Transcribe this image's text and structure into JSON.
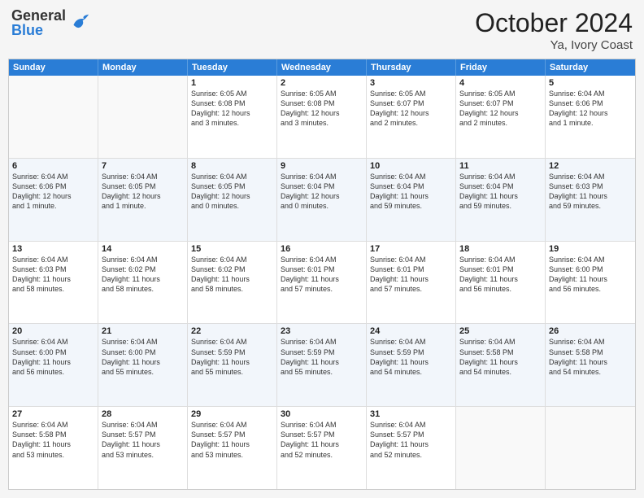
{
  "logo": {
    "general": "General",
    "blue": "Blue"
  },
  "title": "October 2024",
  "subtitle": "Ya, Ivory Coast",
  "header": {
    "days": [
      "Sunday",
      "Monday",
      "Tuesday",
      "Wednesday",
      "Thursday",
      "Friday",
      "Saturday"
    ]
  },
  "rows": [
    {
      "cells": [
        {
          "day": "",
          "lines": []
        },
        {
          "day": "",
          "lines": []
        },
        {
          "day": "1",
          "lines": [
            "Sunrise: 6:05 AM",
            "Sunset: 6:08 PM",
            "Daylight: 12 hours",
            "and 3 minutes."
          ]
        },
        {
          "day": "2",
          "lines": [
            "Sunrise: 6:05 AM",
            "Sunset: 6:08 PM",
            "Daylight: 12 hours",
            "and 3 minutes."
          ]
        },
        {
          "day": "3",
          "lines": [
            "Sunrise: 6:05 AM",
            "Sunset: 6:07 PM",
            "Daylight: 12 hours",
            "and 2 minutes."
          ]
        },
        {
          "day": "4",
          "lines": [
            "Sunrise: 6:05 AM",
            "Sunset: 6:07 PM",
            "Daylight: 12 hours",
            "and 2 minutes."
          ]
        },
        {
          "day": "5",
          "lines": [
            "Sunrise: 6:04 AM",
            "Sunset: 6:06 PM",
            "Daylight: 12 hours",
            "and 1 minute."
          ]
        }
      ]
    },
    {
      "cells": [
        {
          "day": "6",
          "lines": [
            "Sunrise: 6:04 AM",
            "Sunset: 6:06 PM",
            "Daylight: 12 hours",
            "and 1 minute."
          ]
        },
        {
          "day": "7",
          "lines": [
            "Sunrise: 6:04 AM",
            "Sunset: 6:05 PM",
            "Daylight: 12 hours",
            "and 1 minute."
          ]
        },
        {
          "day": "8",
          "lines": [
            "Sunrise: 6:04 AM",
            "Sunset: 6:05 PM",
            "Daylight: 12 hours",
            "and 0 minutes."
          ]
        },
        {
          "day": "9",
          "lines": [
            "Sunrise: 6:04 AM",
            "Sunset: 6:04 PM",
            "Daylight: 12 hours",
            "and 0 minutes."
          ]
        },
        {
          "day": "10",
          "lines": [
            "Sunrise: 6:04 AM",
            "Sunset: 6:04 PM",
            "Daylight: 11 hours",
            "and 59 minutes."
          ]
        },
        {
          "day": "11",
          "lines": [
            "Sunrise: 6:04 AM",
            "Sunset: 6:04 PM",
            "Daylight: 11 hours",
            "and 59 minutes."
          ]
        },
        {
          "day": "12",
          "lines": [
            "Sunrise: 6:04 AM",
            "Sunset: 6:03 PM",
            "Daylight: 11 hours",
            "and 59 minutes."
          ]
        }
      ]
    },
    {
      "cells": [
        {
          "day": "13",
          "lines": [
            "Sunrise: 6:04 AM",
            "Sunset: 6:03 PM",
            "Daylight: 11 hours",
            "and 58 minutes."
          ]
        },
        {
          "day": "14",
          "lines": [
            "Sunrise: 6:04 AM",
            "Sunset: 6:02 PM",
            "Daylight: 11 hours",
            "and 58 minutes."
          ]
        },
        {
          "day": "15",
          "lines": [
            "Sunrise: 6:04 AM",
            "Sunset: 6:02 PM",
            "Daylight: 11 hours",
            "and 58 minutes."
          ]
        },
        {
          "day": "16",
          "lines": [
            "Sunrise: 6:04 AM",
            "Sunset: 6:01 PM",
            "Daylight: 11 hours",
            "and 57 minutes."
          ]
        },
        {
          "day": "17",
          "lines": [
            "Sunrise: 6:04 AM",
            "Sunset: 6:01 PM",
            "Daylight: 11 hours",
            "and 57 minutes."
          ]
        },
        {
          "day": "18",
          "lines": [
            "Sunrise: 6:04 AM",
            "Sunset: 6:01 PM",
            "Daylight: 11 hours",
            "and 56 minutes."
          ]
        },
        {
          "day": "19",
          "lines": [
            "Sunrise: 6:04 AM",
            "Sunset: 6:00 PM",
            "Daylight: 11 hours",
            "and 56 minutes."
          ]
        }
      ]
    },
    {
      "cells": [
        {
          "day": "20",
          "lines": [
            "Sunrise: 6:04 AM",
            "Sunset: 6:00 PM",
            "Daylight: 11 hours",
            "and 56 minutes."
          ]
        },
        {
          "day": "21",
          "lines": [
            "Sunrise: 6:04 AM",
            "Sunset: 6:00 PM",
            "Daylight: 11 hours",
            "and 55 minutes."
          ]
        },
        {
          "day": "22",
          "lines": [
            "Sunrise: 6:04 AM",
            "Sunset: 5:59 PM",
            "Daylight: 11 hours",
            "and 55 minutes."
          ]
        },
        {
          "day": "23",
          "lines": [
            "Sunrise: 6:04 AM",
            "Sunset: 5:59 PM",
            "Daylight: 11 hours",
            "and 55 minutes."
          ]
        },
        {
          "day": "24",
          "lines": [
            "Sunrise: 6:04 AM",
            "Sunset: 5:59 PM",
            "Daylight: 11 hours",
            "and 54 minutes."
          ]
        },
        {
          "day": "25",
          "lines": [
            "Sunrise: 6:04 AM",
            "Sunset: 5:58 PM",
            "Daylight: 11 hours",
            "and 54 minutes."
          ]
        },
        {
          "day": "26",
          "lines": [
            "Sunrise: 6:04 AM",
            "Sunset: 5:58 PM",
            "Daylight: 11 hours",
            "and 54 minutes."
          ]
        }
      ]
    },
    {
      "cells": [
        {
          "day": "27",
          "lines": [
            "Sunrise: 6:04 AM",
            "Sunset: 5:58 PM",
            "Daylight: 11 hours",
            "and 53 minutes."
          ]
        },
        {
          "day": "28",
          "lines": [
            "Sunrise: 6:04 AM",
            "Sunset: 5:57 PM",
            "Daylight: 11 hours",
            "and 53 minutes."
          ]
        },
        {
          "day": "29",
          "lines": [
            "Sunrise: 6:04 AM",
            "Sunset: 5:57 PM",
            "Daylight: 11 hours",
            "and 53 minutes."
          ]
        },
        {
          "day": "30",
          "lines": [
            "Sunrise: 6:04 AM",
            "Sunset: 5:57 PM",
            "Daylight: 11 hours",
            "and 52 minutes."
          ]
        },
        {
          "day": "31",
          "lines": [
            "Sunrise: 6:04 AM",
            "Sunset: 5:57 PM",
            "Daylight: 11 hours",
            "and 52 minutes."
          ]
        },
        {
          "day": "",
          "lines": []
        },
        {
          "day": "",
          "lines": []
        }
      ]
    }
  ]
}
